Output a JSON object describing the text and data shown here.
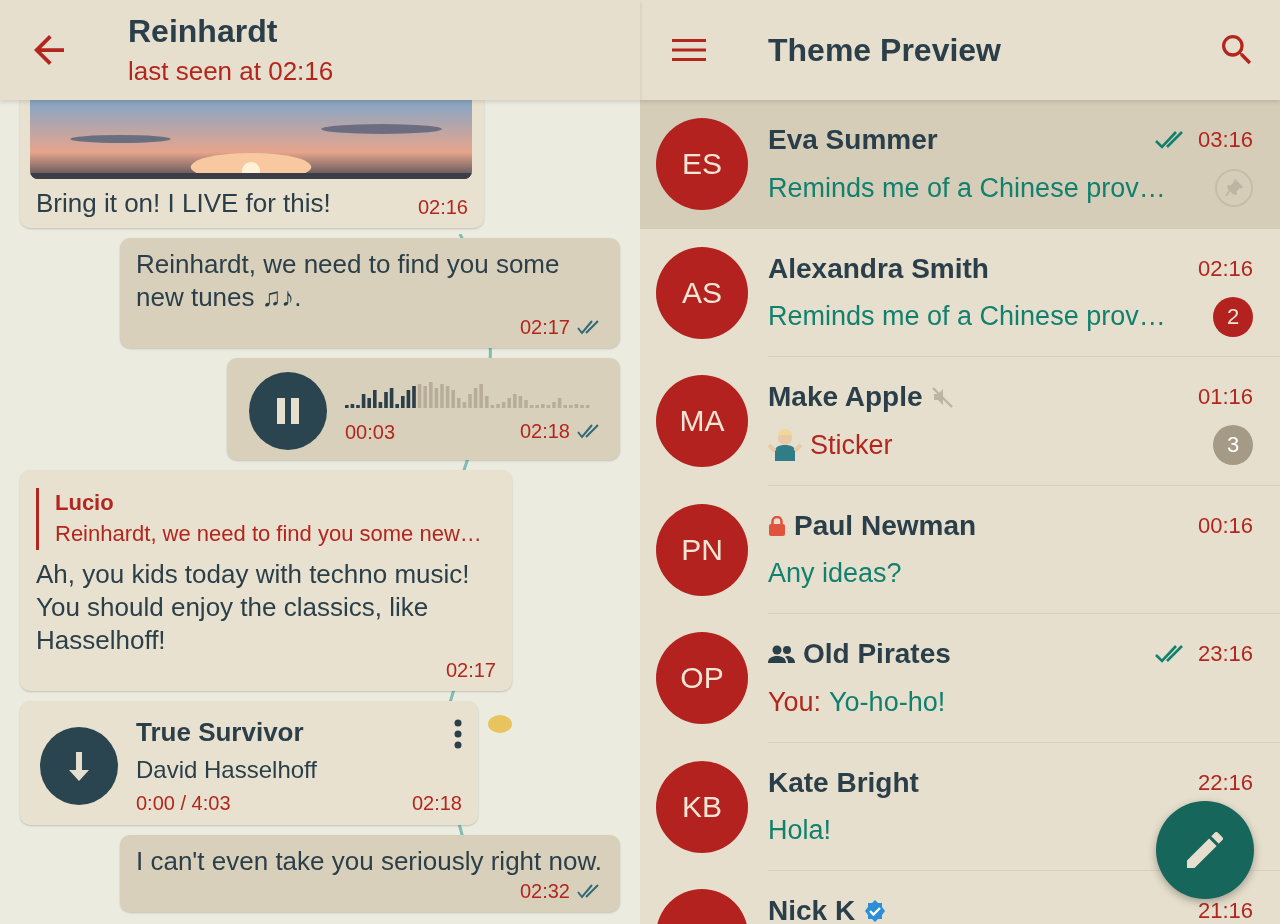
{
  "chat": {
    "title": "Reinhardt",
    "status": "last seen at 02:16"
  },
  "messages": [
    {
      "outgoing": false,
      "text": "Bring it on! I LIVE for this!",
      "time": "02:16"
    },
    {
      "kind": "text",
      "outgoing": true,
      "text": "Reinhardt, we need to find you some new tunes ♫♪.",
      "time": "02:17",
      "read": true
    },
    {
      "kind": "voice",
      "outgoing": true,
      "duration": "00:03",
      "level": 0.3,
      "time": "02:18",
      "read": true
    },
    {
      "kind": "reply",
      "outgoing": false,
      "reply_author": "Lucio",
      "reply_text": "Reinhardt, we need to find you some new…",
      "text": "Ah, you kids today with techno music! You should enjoy the classics, like Hasselhoff!",
      "time": "02:17"
    },
    {
      "kind": "audio",
      "outgoing": false,
      "title": "True Survivor",
      "artist": "David Hasselhoff",
      "length": "0:00 / 4:03",
      "time": "02:18"
    },
    {
      "kind": "text",
      "outgoing": true,
      "text": "I can't even take you seriously right now.",
      "time": "02:32",
      "read": true
    }
  ],
  "list": {
    "title": "Theme Preview"
  },
  "chats": [
    {
      "kind": "chat",
      "initials": "ES",
      "name": "Eva Summer",
      "time": "03:16",
      "preview": "Reminds me of a Chinese prov…",
      "read": true,
      "pinned": true,
      "selected": true
    },
    {
      "kind": "chat",
      "initials": "AS",
      "name": "Alexandra Smith",
      "time": "02:16",
      "preview": "Reminds me of a Chinese prov…",
      "unread": "2",
      "selected": false
    },
    {
      "kind": "chat",
      "initials": "MA",
      "name": "Make Apple",
      "time": "01:16",
      "preview": "Sticker",
      "sticker": true,
      "unread": "3",
      "muted": true,
      "selected": false
    },
    {
      "kind": "secret",
      "initials": "PN",
      "name": "Paul Newman",
      "time": "00:16",
      "preview": "Any ideas?",
      "selected": false
    },
    {
      "kind": "group",
      "initials": "OP",
      "name": "Old Pirates",
      "time": "23:16",
      "sender": "You:",
      "preview": "Yo-ho-ho!",
      "read": true,
      "selected": false
    },
    {
      "kind": "chat",
      "initials": "KB",
      "name": "Kate Bright",
      "time": "22:16",
      "preview": "Hola!",
      "selected": false
    },
    {
      "kind": "channel",
      "name": "Nick K",
      "time": "21:16",
      "selected": false
    }
  ]
}
